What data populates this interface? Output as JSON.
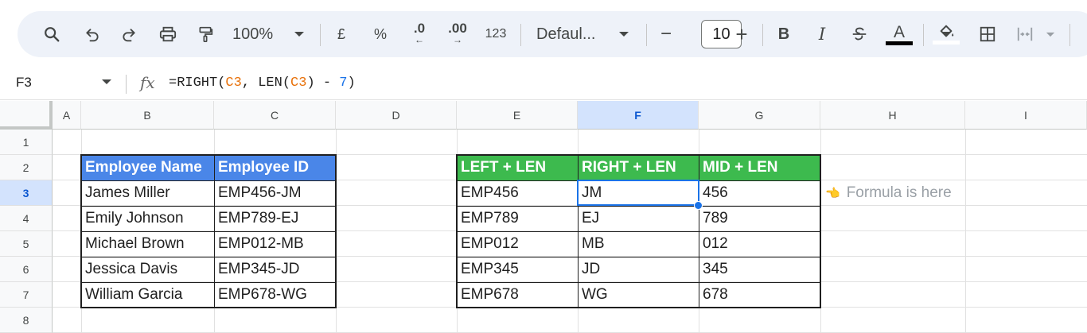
{
  "toolbar": {
    "zoom": "100%",
    "currency_symbol": "£",
    "percent_symbol": "%",
    "decrease_decimal": ".0",
    "increase_decimal": ".00",
    "number_format": "123",
    "font_name": "Defaul...",
    "font_size": "10",
    "minus": "−",
    "plus": "+",
    "bold": "B",
    "italic": "I",
    "text_color_letter": "A"
  },
  "formula_bar": {
    "cell_ref": "F3",
    "fx": "fx",
    "formula": {
      "prefix": "=RIGHT(",
      "ref1": "C3",
      "mid": ", LEN(",
      "ref2": "C3",
      "after": ") - ",
      "num": "7",
      "suffix": ")"
    }
  },
  "colors": {
    "ref_color": "#e8710a",
    "num_color": "#1a73e8",
    "blue_header": "#4a86e8",
    "green_header": "#3dba4e",
    "selection": "#1a73e8"
  },
  "columns": [
    "A",
    "B",
    "C",
    "D",
    "E",
    "F",
    "G",
    "H",
    "I"
  ],
  "rows": [
    "1",
    "2",
    "3",
    "4",
    "5",
    "6",
    "7",
    "8"
  ],
  "selected_cell": "F3",
  "table1": {
    "headers": [
      "Employee Name",
      "Employee ID"
    ],
    "rows": [
      [
        "James Miller",
        "EMP456-JM"
      ],
      [
        "Emily Johnson",
        "EMP789-EJ"
      ],
      [
        "Michael Brown",
        "EMP012-MB"
      ],
      [
        "Jessica Davis",
        "EMP345-JD"
      ],
      [
        "William Garcia",
        "EMP678-WG"
      ]
    ]
  },
  "table2": {
    "headers": [
      "LEFT + LEN",
      "RIGHT + LEN",
      "MID + LEN"
    ],
    "rows": [
      [
        "EMP456",
        "JM",
        "456"
      ],
      [
        "EMP789",
        "EJ",
        "789"
      ],
      [
        "EMP012",
        "MB",
        "012"
      ],
      [
        "EMP345",
        "JD",
        "345"
      ],
      [
        "EMP678",
        "WG",
        "678"
      ]
    ]
  },
  "annotation": {
    "icon": "pointing-hand-icon",
    "glyph": "👈",
    "text": "Formula is here"
  }
}
